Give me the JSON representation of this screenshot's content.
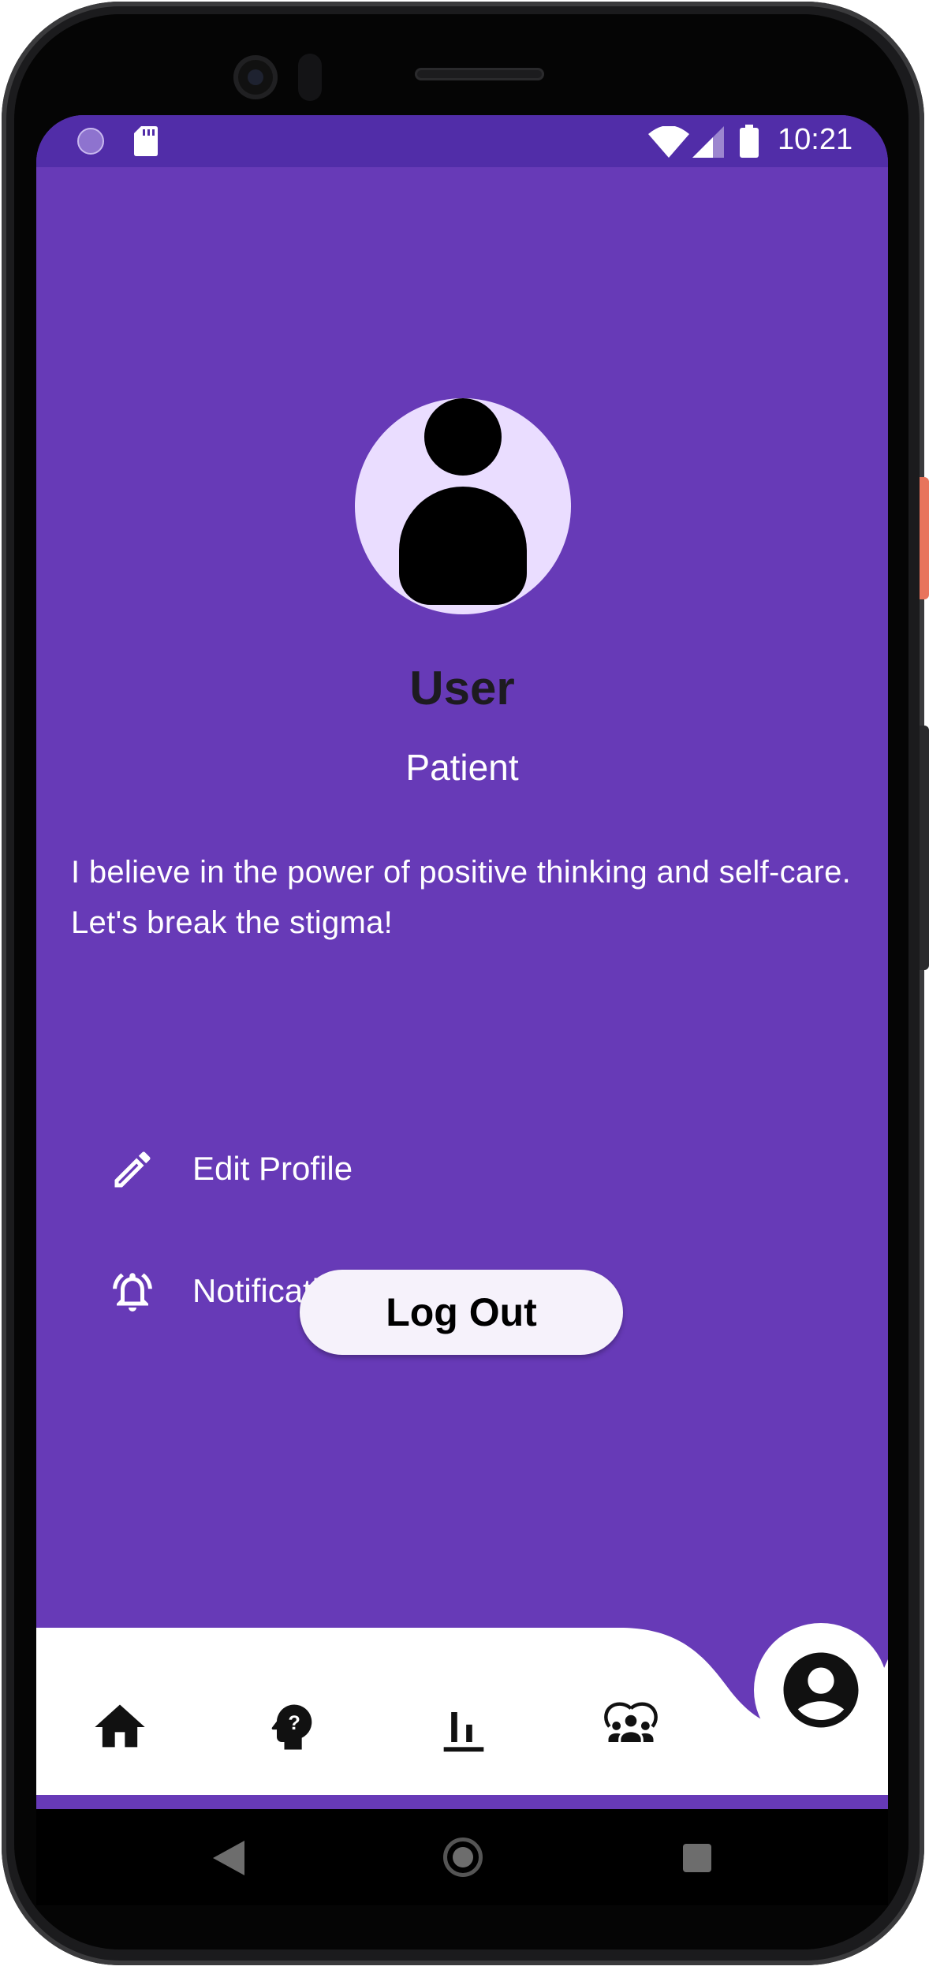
{
  "status_bar": {
    "time": "10:21",
    "left_icons": [
      "progress-circle-icon",
      "sd-card-icon"
    ],
    "right_icons": [
      "wifi-icon",
      "cell-signal-icon",
      "battery-icon"
    ]
  },
  "profile": {
    "avatar_icon": "person-avatar-icon",
    "name": "User",
    "role": "Patient",
    "bio": "I believe in the power of positive thinking and self-care. Let's break the stigma!"
  },
  "menu": {
    "edit_profile": {
      "label": "Edit Profile",
      "icon": "pencil-icon"
    },
    "notification_settings": {
      "label": "Notification Settings",
      "icon": "alarm-bell-icon"
    }
  },
  "logout_label": "Log Out",
  "bottom_nav": {
    "items": [
      {
        "name": "home",
        "icon": "home-icon"
      },
      {
        "name": "help",
        "icon": "head-question-icon"
      },
      {
        "name": "stats",
        "icon": "bar-chart-icon"
      },
      {
        "name": "community",
        "icon": "group-icon"
      }
    ],
    "active": {
      "name": "profile",
      "icon": "account-circle-icon"
    }
  },
  "system_nav": [
    "back-triangle-icon",
    "home-circle-icon",
    "recents-square-icon"
  ],
  "colors": {
    "primary": "#673ab7",
    "status_bar": "#512da8",
    "avatar_bg": "#eaddff",
    "name_text": "#1d1b20",
    "button_bg": "#f6f2fb"
  }
}
